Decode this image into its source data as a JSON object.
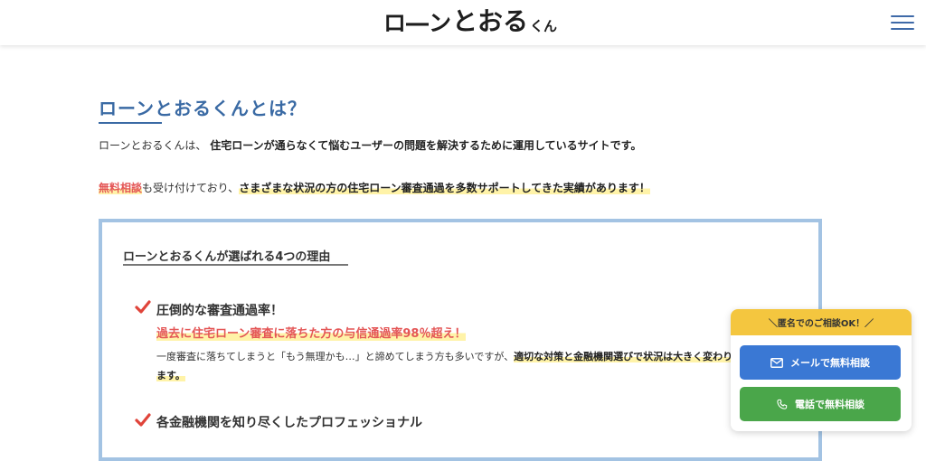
{
  "header": {
    "logo_part1": "ロ―ン",
    "logo_part2": "とおる",
    "logo_part3": "くん",
    "menu_icon": "hamburger-menu-icon"
  },
  "intro": {
    "title": "ローンとおるくんとは？",
    "para1_plain": "ローンとおるくんは、",
    "para1_bold": "住宅ローンが通らなくて悩むユーザーの問題を解決するために運用しているサイトです。",
    "para2_red": "無料相談",
    "para2_plain": "も受け付けており、",
    "para2_highlight": "さまざまな状況の方の住宅ローン審査通過を多数サポートしてきた実績があります！"
  },
  "reasons": {
    "title": "ローンとおるくんが選ばれる4つの理由",
    "items": [
      {
        "title": "圧倒的な審査通過率！",
        "highlight": "過去に住宅ローン審査に落ちた方の与信通過率98％超え！",
        "desc_plain": "一度審査に落ちてしまうと「もう無理かも…」と諦めてしまう方も多いですが、",
        "desc_highlight": "適切な対策と金融機関選びで状況は大きく変わります。"
      },
      {
        "title": "各金融機関を知り尽くしたプロフェッショナル"
      }
    ]
  },
  "consult_widget": {
    "header": "＼匿名でのご相談OK！／",
    "mail_button": "メールで無料相談",
    "phone_button": "電話で無料相談"
  },
  "colors": {
    "accent_blue": "#3a6aa4",
    "box_border": "#a3c3e3",
    "red_text": "#e45656",
    "highlight_yellow": "#fff3a8",
    "mail_button": "#3a78d4",
    "phone_button": "#4aa64a",
    "widget_header": "#f4c63f"
  }
}
